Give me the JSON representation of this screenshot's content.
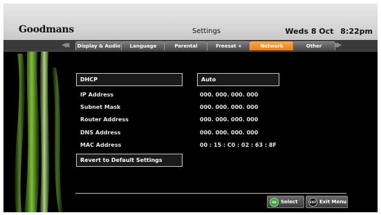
{
  "header": {
    "brand": "Goodmans",
    "title": "Settings",
    "day_date": "Weds 8 Oct",
    "time": "8:22pm"
  },
  "tabs": [
    {
      "label": "Display & Audio",
      "active": false
    },
    {
      "label": "Language",
      "active": false
    },
    {
      "label": "Parental",
      "active": false
    },
    {
      "label": "Freesat +",
      "active": false
    },
    {
      "label": "Network",
      "active": true
    },
    {
      "label": "Other",
      "active": false
    }
  ],
  "network": {
    "dhcp": {
      "label": "DHCP",
      "value": "Auto"
    },
    "rows": [
      {
        "label": "IP Address",
        "value": "000. 000. 000. 000"
      },
      {
        "label": "Subnet Mask",
        "value": "000. 000. 000. 000"
      },
      {
        "label": "Router Address",
        "value": "000. 000. 000. 000"
      },
      {
        "label": "DNS Address",
        "value": "000. 000. 000. 000"
      },
      {
        "label": "MAC Address",
        "value": "00 : 15 : C0 : 02 : 63 : 8F"
      }
    ],
    "reset_label": "Revert to Default Settings"
  },
  "footer": {
    "select": {
      "icon": "OK",
      "label": "Select"
    },
    "exit": {
      "icon": "EXIT",
      "label": "Exit Menu"
    }
  },
  "colors": {
    "active_tab": "#f07a10",
    "ok_button": "#3ca23c",
    "exit_button": "#2a2a2a",
    "leaf_green": "#8ed43a"
  }
}
